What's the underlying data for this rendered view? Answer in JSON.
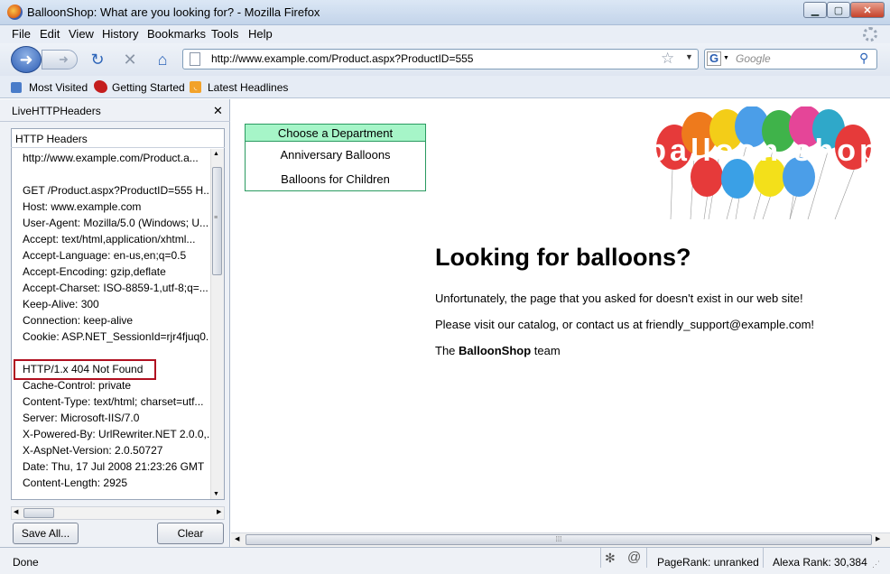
{
  "window": {
    "title": "BalloonShop: What are you looking for? - Mozilla Firefox"
  },
  "menu": [
    "File",
    "Edit",
    "View",
    "History",
    "Bookmarks",
    "Tools",
    "Help"
  ],
  "nav": {
    "url": "http://www.example.com/Product.aspx?ProductID=555",
    "search_placeholder": "Google"
  },
  "bookmarks": [
    "Most Visited",
    "Getting Started",
    "Latest Headlines"
  ],
  "sidebar": {
    "title": "LiveHTTPHeaders",
    "box_title": "HTTP Headers",
    "request_url": "http://www.example.com/Product.a...",
    "request_lines": [
      "GET /Product.aspx?ProductID=555 H...",
      "Host: www.example.com",
      "User-Agent: Mozilla/5.0 (Windows; U...",
      "Accept: text/html,application/xhtml...",
      "Accept-Language: en-us,en;q=0.5",
      "Accept-Encoding: gzip,deflate",
      "Accept-Charset: ISO-8859-1,utf-8;q=...",
      "Keep-Alive: 300",
      "Connection: keep-alive",
      "Cookie: ASP.NET_SessionId=rjr4fjuq0..."
    ],
    "response_lines": [
      "HTTP/1.x 404 Not Found",
      "Cache-Control: private",
      "Content-Type: text/html; charset=utf...",
      "Server: Microsoft-IIS/7.0",
      "X-Powered-By: UrlRewriter.NET 2.0.0,...",
      "X-AspNet-Version: 2.0.50727",
      "Date: Thu, 17 Jul 2008 21:23:26 GMT",
      "Content-Length: 2925"
    ],
    "save_all": "Save All...",
    "clear": "Clear"
  },
  "page": {
    "dept_title": "Choose a Department",
    "dept_links": [
      "Anniversary Balloons",
      "Balloons for Children"
    ],
    "heading": "Looking for balloons?",
    "para1": "Unfortunately, the page that you asked for doesn't exist in our web site!",
    "para2": "Please visit our catalog, or contact us at friendly_support@example.com!",
    "para3_prefix": "The ",
    "para3_bold": "BalloonShop",
    "para3_suffix": " team",
    "logo_text": "balloon shop"
  },
  "status": {
    "left": "Done",
    "pagerank": "PageRank: unranked",
    "alexa": "Alexa Rank: 30,384"
  }
}
